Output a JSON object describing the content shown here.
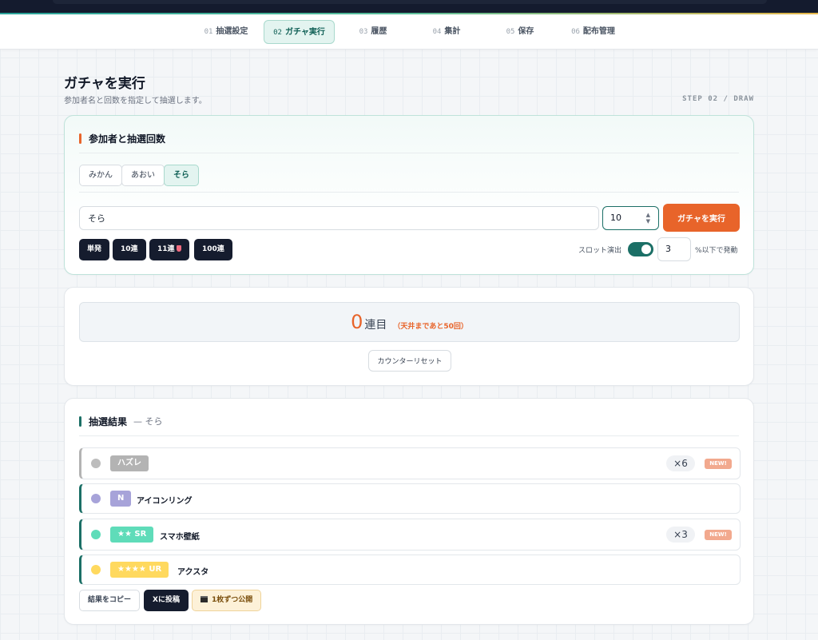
{
  "steps": [
    {
      "num": "01",
      "label": "抽選設定"
    },
    {
      "num": "02",
      "label": "ガチャ実行"
    },
    {
      "num": "03",
      "label": "履歴"
    },
    {
      "num": "04",
      "label": "集計"
    },
    {
      "num": "05",
      "label": "保存"
    },
    {
      "num": "06",
      "label": "配布管理"
    }
  ],
  "active_step": "02",
  "page": {
    "title": "ガチャを実行",
    "subtitle": "参加者名と回数を指定して抽選します。",
    "step_tag": "STEP 02 / DRAW"
  },
  "participants": {
    "heading": "参加者と抽選回数",
    "chips": [
      "みかん",
      "あおい",
      "そら"
    ],
    "selected": "そら",
    "name_value": "そら",
    "count_value": "10",
    "run_label": "ガチャを実行",
    "quick": [
      "単発",
      "10連",
      "11連",
      "100連"
    ],
    "slot_label": "スロット演出",
    "slot_on": true,
    "threshold_value": "3",
    "threshold_label": "%以下で発動"
  },
  "counter": {
    "count": "0",
    "unit": "連目",
    "ceiling_text": "（天井まであと50回）",
    "reset_label": "カウンターリセット"
  },
  "results": {
    "heading": "抽選結果",
    "subject": "— そら",
    "rows": [
      {
        "rarity": "ハズレ",
        "name": "",
        "qty": "×6",
        "new": "NEW!"
      },
      {
        "rarity": "N",
        "name": "アイコンリング",
        "qty": "",
        "new": ""
      },
      {
        "rarity": "★★ SR",
        "name": "スマホ壁紙",
        "qty": "×3",
        "new": "NEW!"
      },
      {
        "rarity": "★★★★ UR",
        "name": "アクスタ",
        "qty": "",
        "new": ""
      }
    ],
    "actions": [
      "結果をコピー",
      "Xに投稿",
      "1枚ずつ公開"
    ]
  },
  "colors": {
    "accent": "#e8642a",
    "teal": "#1b6f66",
    "navy": "#151c2e",
    "hazure": "#b3b3b3",
    "n": "#a7a3d9",
    "sr": "#5fdcb9",
    "ur": "#ffd95e"
  },
  "icons": {
    "gem": "gem-icon",
    "clapper": "clapperboard-icon",
    "spin": "spinner-arrows-icon"
  }
}
